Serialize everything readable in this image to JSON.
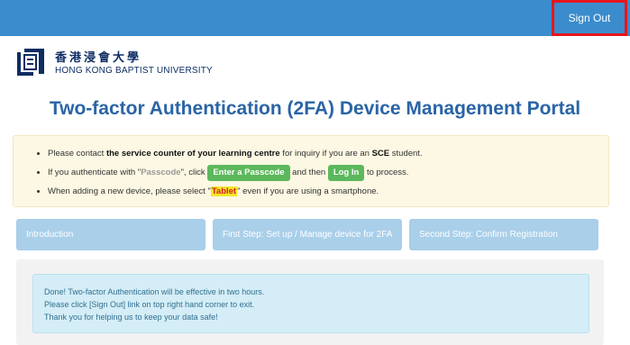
{
  "header": {
    "signout_label": "Sign Out"
  },
  "brand": {
    "name_zh": "香港浸會大學",
    "name_en": "HONG KONG BAPTIST UNIVERSITY"
  },
  "page": {
    "title": "Two-factor Authentication (2FA) Device Management Portal"
  },
  "notice": {
    "line1": {
      "a": "Please contact ",
      "b": "the service counter of your learning centre",
      "c": " for inquiry if you are an ",
      "d": "SCE",
      "e": " student."
    },
    "line2": {
      "a": "If you authenticate with \"",
      "b": "Passcode",
      "c": "\", click ",
      "btn1": "Enter a Passcode",
      "d": " and then ",
      "btn2": "Log In",
      "e": " to process."
    },
    "line3": {
      "a": "When adding a new device, please select \"",
      "b": "Tablet",
      "c": "\" even if you are using a smartphone."
    }
  },
  "steps": [
    {
      "label": "Introduction"
    },
    {
      "label": "First Step: Set up / Manage device for 2FA"
    },
    {
      "label": "Second Step: Confirm Registration"
    }
  ],
  "message": {
    "line1": "Done! Two-factor Authentication will be effective in two hours.",
    "line2": "Please click [Sign Out] link on top right hand corner to exit.",
    "line3": "Thank you for helping us to keep your data safe!"
  },
  "colors": {
    "topbar": "#3a8ccd",
    "title": "#2a64a6",
    "step": "#a9cfe9",
    "success_btn": "#5cb85c",
    "highlight_box": "#e8141c"
  }
}
